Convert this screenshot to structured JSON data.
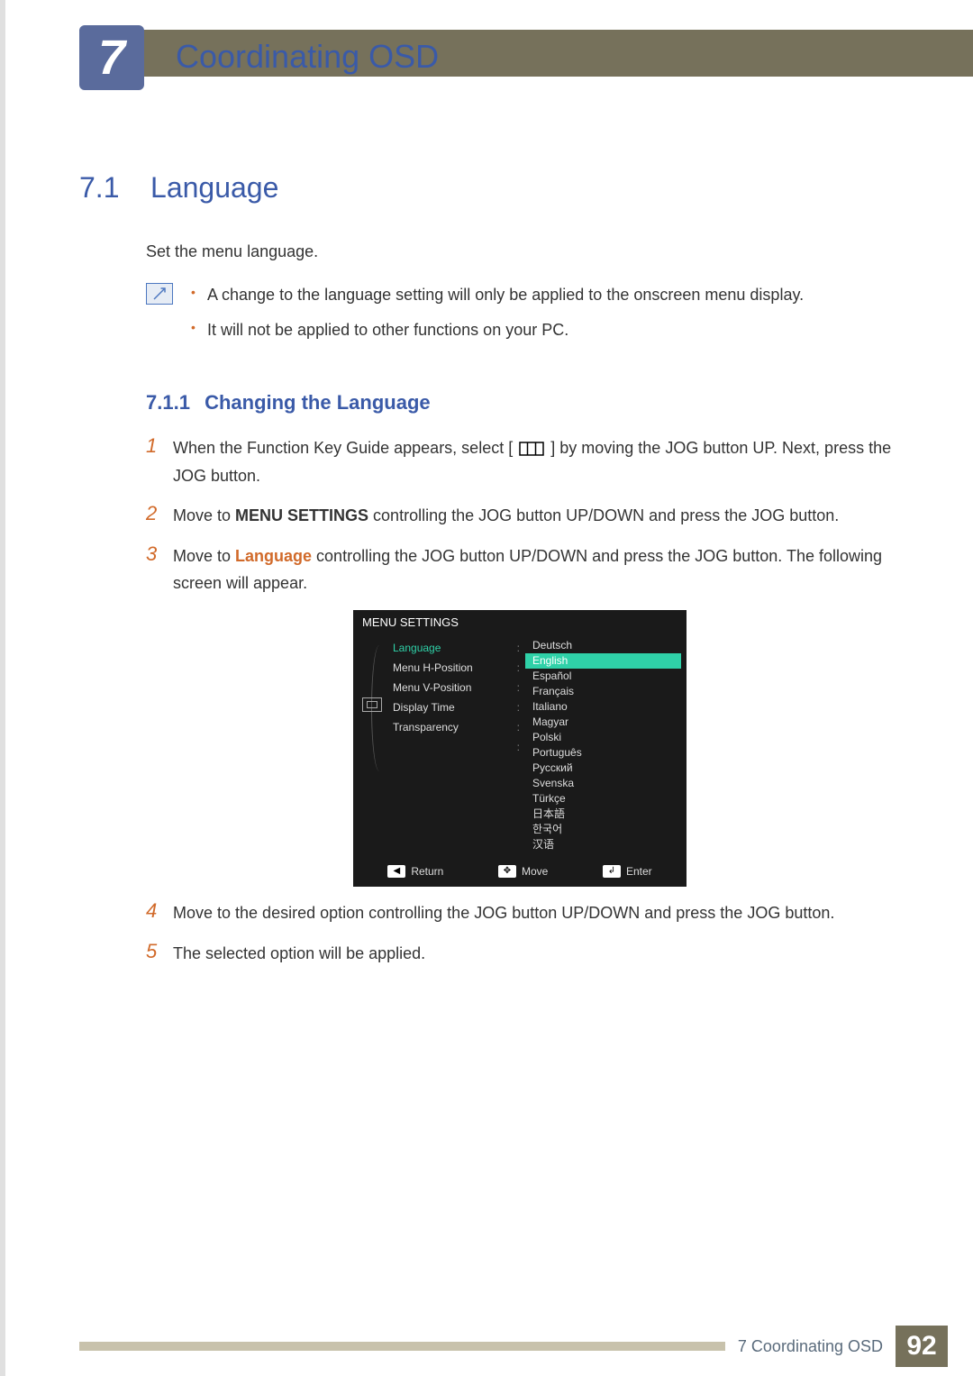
{
  "chapter": {
    "number": "7",
    "title": "Coordinating OSD"
  },
  "section": {
    "number": "7.1",
    "title": "Language",
    "intro": "Set the menu language."
  },
  "notes": [
    "A change to the language setting will only be applied to the onscreen menu display.",
    "It will not be applied to other functions on your PC."
  ],
  "subsection": {
    "number": "7.1.1",
    "title": "Changing the Language"
  },
  "steps": {
    "s1a": "When the Function Key Guide appears, select [",
    "s1b": "] by moving the JOG button UP. Next, press the JOG button.",
    "s2a": "Move to ",
    "s2b_bold": "MENU SETTINGS",
    "s2c": " controlling the JOG button UP/DOWN and press the JOG button.",
    "s3a": "Move to ",
    "s3b_bold": "Language",
    "s3c": " controlling the JOG button UP/DOWN and press the JOG button. The following screen will appear.",
    "s4": "Move to the desired option controlling the JOG button UP/DOWN and press the JOG button.",
    "s5": "The selected option will be applied."
  },
  "step_nums": {
    "1": "1",
    "2": "2",
    "3": "3",
    "4": "4",
    "5": "5"
  },
  "osd": {
    "title": "MENU SETTINGS",
    "menu_items": [
      "Language",
      "Menu H-Position",
      "Menu V-Position",
      "Display Time",
      "Transparency"
    ],
    "languages": [
      "Deutsch",
      "English",
      "Español",
      "Français",
      "Italiano",
      "Magyar",
      "Polski",
      "Português",
      "Русский",
      "Svenska",
      "Türkçe",
      "日本語",
      "한국어",
      "汉语"
    ],
    "selected_language_index": 1,
    "footer": {
      "return": "Return",
      "move": "Move",
      "enter": "Enter"
    }
  },
  "footer": {
    "label": "7 Coordinating OSD",
    "page": "92"
  }
}
